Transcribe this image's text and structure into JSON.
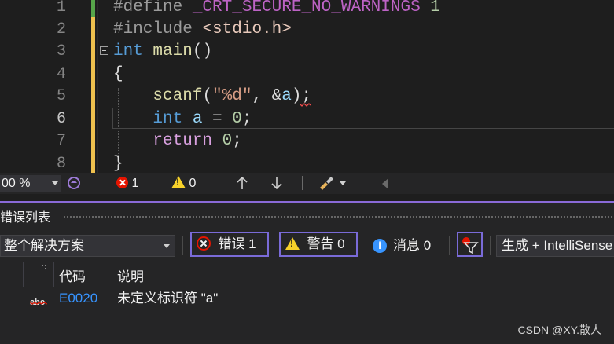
{
  "editor": {
    "line_numbers": [
      "1",
      "2",
      "3",
      "4",
      "5",
      "6",
      "7",
      "8"
    ],
    "lines": {
      "l1": {
        "directive": "#define",
        "macro": "_CRT_SECURE_NO_WARNINGS",
        "value": "1"
      },
      "l2": {
        "directive": "#include",
        "header": "<stdio.h>"
      },
      "l3": {
        "type": "int",
        "name": "main",
        "parens": "()"
      },
      "l4": {
        "brace": "{"
      },
      "l5": {
        "fn": "scanf",
        "open": "(",
        "fmt": "\"%d\"",
        "mid": ", &",
        "var": "a",
        "close": ");"
      },
      "l6": {
        "type": "int",
        "var": "a",
        "op": " = ",
        "num": "0",
        "end": ";"
      },
      "l7": {
        "ret": "return",
        "num": "0",
        "end": ";"
      },
      "l8": {
        "brace": "}"
      }
    }
  },
  "status_strip": {
    "zoom": "00 %",
    "error_count": "1",
    "warning_count": "0"
  },
  "error_list": {
    "title": "错误列表",
    "scope": "整个解决方案",
    "errors_btn": "错误 1",
    "warnings_btn": "警告 0",
    "messages": "消息 0",
    "build_filter": "生成 + IntelliSense",
    "columns": {
      "code": "代码",
      "desc": "说明"
    },
    "rows": [
      {
        "code": "E0020",
        "desc": "未定义标识符 \"a\""
      }
    ]
  },
  "watermark": "CSDN @XY.散人",
  "colors": {
    "accent": "#7a6bd8",
    "error": "#e51400",
    "warning": "#f8d22a",
    "link": "#3794ff"
  }
}
